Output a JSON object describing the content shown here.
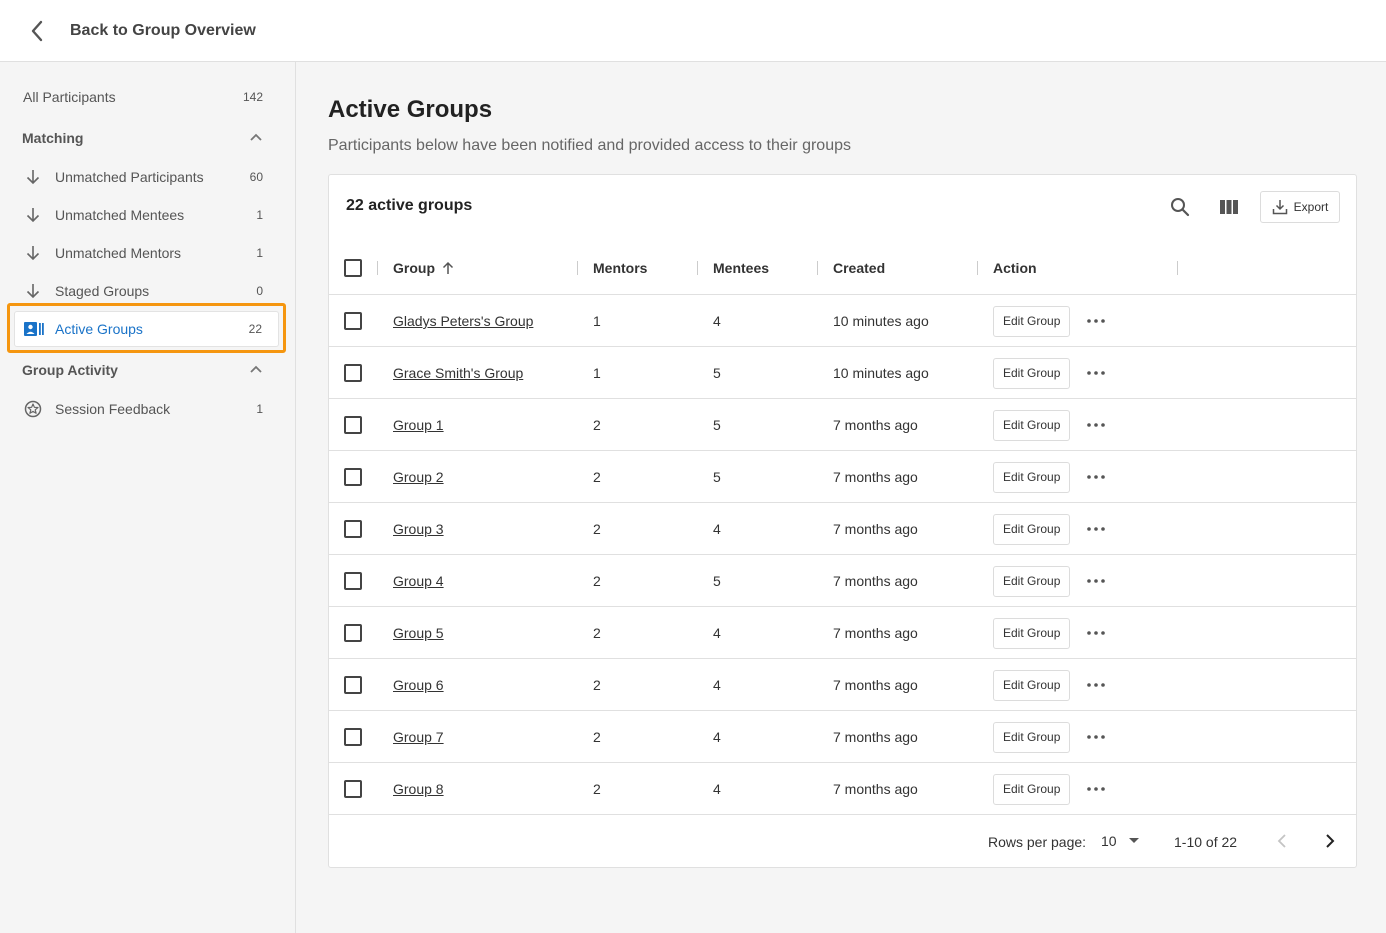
{
  "header": {
    "back_label": "Back to Group Overview"
  },
  "sidebar": {
    "all_participants": {
      "label": "All Participants",
      "count": "142"
    },
    "matching": {
      "label": "Matching",
      "items": [
        {
          "label": "Unmatched Participants",
          "count": "60",
          "icon": "arrow-down-icon"
        },
        {
          "label": "Unmatched Mentees",
          "count": "1",
          "icon": "arrow-down-icon"
        },
        {
          "label": "Unmatched Mentors",
          "count": "1",
          "icon": "arrow-down-icon"
        },
        {
          "label": "Staged Groups",
          "count": "0",
          "icon": "arrow-down-icon"
        },
        {
          "label": "Active Groups",
          "count": "22",
          "icon": "group-card-icon",
          "active": true
        }
      ]
    },
    "group_activity": {
      "label": "Group Activity",
      "items": [
        {
          "label": "Session Feedback",
          "count": "1",
          "icon": "feedback-icon"
        }
      ]
    }
  },
  "main": {
    "title": "Active Groups",
    "subtitle": "Participants below have been notified and provided access to their groups"
  },
  "table": {
    "title": "22 active groups",
    "export_label": "Export",
    "columns": {
      "group": "Group",
      "mentors": "Mentors",
      "mentees": "Mentees",
      "created": "Created",
      "action": "Action"
    },
    "edit_label": "Edit Group",
    "rows": [
      {
        "group": "Gladys Peters's Group",
        "mentors": "1",
        "mentees": "4",
        "created": "10 minutes ago"
      },
      {
        "group": "Grace Smith's Group",
        "mentors": "1",
        "mentees": "5",
        "created": "10 minutes ago"
      },
      {
        "group": "Group 1",
        "mentors": "2",
        "mentees": "5",
        "created": "7 months ago"
      },
      {
        "group": "Group 2",
        "mentors": "2",
        "mentees": "5",
        "created": "7 months ago"
      },
      {
        "group": "Group 3",
        "mentors": "2",
        "mentees": "4",
        "created": "7 months ago"
      },
      {
        "group": "Group 4",
        "mentors": "2",
        "mentees": "5",
        "created": "7 months ago"
      },
      {
        "group": "Group 5",
        "mentors": "2",
        "mentees": "4",
        "created": "7 months ago"
      },
      {
        "group": "Group 6",
        "mentors": "2",
        "mentees": "4",
        "created": "7 months ago"
      },
      {
        "group": "Group 7",
        "mentors": "2",
        "mentees": "4",
        "created": "7 months ago"
      },
      {
        "group": "Group 8",
        "mentors": "2",
        "mentees": "4",
        "created": "7 months ago"
      }
    ]
  },
  "pagination": {
    "rows_per_page_label": "Rows per page:",
    "rows_per_page": "10",
    "range": "1-10 of 22"
  },
  "colors": {
    "accent": "#1a73c8",
    "highlight": "#f5960f"
  }
}
